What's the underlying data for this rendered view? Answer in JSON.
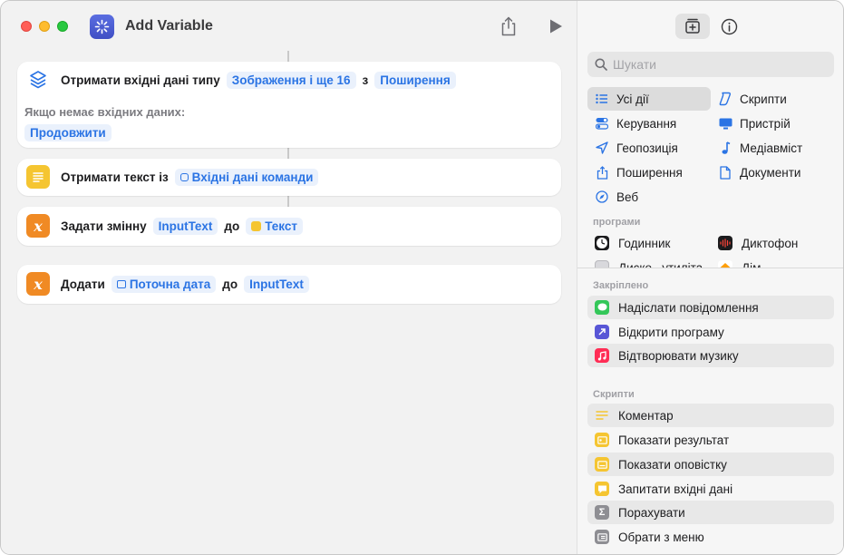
{
  "window": {
    "title": "Add Variable"
  },
  "colors": {
    "accent": "#2b74e4",
    "token_bg": "#eaf1fc",
    "variable_orange": "#f08a24",
    "text_yellow": "#f5c531"
  },
  "actions": [
    {
      "label": "Отримати вхідні дані типу",
      "token1": "Зображення і ще 16",
      "joiner": "з",
      "token2": "Поширення",
      "no_input_label": "Якщо немає вхідних даних:",
      "no_input_value": "Продовжити",
      "icon": "layers-stack-icon"
    },
    {
      "label": "Отримати текст із",
      "token1": "Вхідні дані команди",
      "icon": "text-lines-icon"
    },
    {
      "label": "Задати змінну",
      "token1": "InputText",
      "joiner": "до",
      "token2": "Текст",
      "icon": "variable-x-icon"
    },
    {
      "label": "Додати",
      "token1": "Поточна дата",
      "joiner": "до",
      "token2": "InputText",
      "icon": "variable-x-icon"
    }
  ],
  "sidebar": {
    "search_placeholder": "Шукати",
    "categories": [
      {
        "label": "Усі дії",
        "icon": "list-icon",
        "selected": true
      },
      {
        "label": "Скрипти",
        "icon": "scroll-icon"
      },
      {
        "label": "Керування",
        "icon": "toggles-icon"
      },
      {
        "label": "Пристрій",
        "icon": "monitor-icon"
      },
      {
        "label": "Геопозиція",
        "icon": "location-arrow-icon"
      },
      {
        "label": "Медіавміст",
        "icon": "music-note-icon"
      },
      {
        "label": "Поширення",
        "icon": "share-icon"
      },
      {
        "label": "Документи",
        "icon": "document-icon"
      },
      {
        "label": "Веб",
        "icon": "compass-icon"
      }
    ],
    "apps_header": "програми",
    "apps": [
      {
        "label": "Годинник",
        "icon": "clock-icon"
      },
      {
        "label": "Диктофон",
        "icon": "voice-memos-icon"
      },
      {
        "label": "Диско.. утиліта",
        "icon": "disk-utility-icon"
      },
      {
        "label": "Дім",
        "icon": "home-icon"
      }
    ],
    "pinned_header": "Закріплено",
    "pinned": [
      {
        "label": "Надіслати повідомлення",
        "icon": "messages-icon"
      },
      {
        "label": "Відкрити програму",
        "icon": "open-app-icon"
      },
      {
        "label": "Відтворювати музику",
        "icon": "music-icon"
      }
    ],
    "scripts_header": "Скрипти",
    "scripts": [
      {
        "label": "Коментар",
        "icon": "comment-lines-icon"
      },
      {
        "label": "Показати результат",
        "icon": "show-result-icon"
      },
      {
        "label": "Показати оповістку",
        "icon": "alert-icon"
      },
      {
        "label": "Запитати вхідні дані",
        "icon": "ask-input-icon"
      },
      {
        "label": "Порахувати",
        "icon": "sigma-icon"
      },
      {
        "label": "Обрати з меню",
        "icon": "menu-icon"
      }
    ]
  }
}
